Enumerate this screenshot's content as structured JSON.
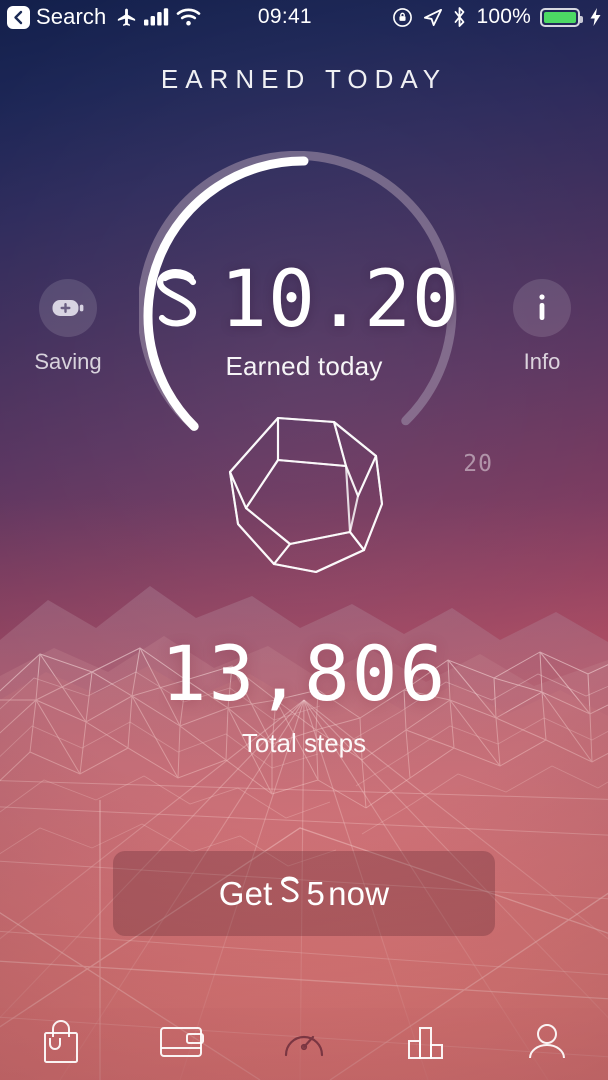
{
  "status_bar": {
    "back_label": "Search",
    "time": "09:41",
    "battery_percent": "100%",
    "icons": [
      "back-chevron-icon",
      "airplane-mode-icon",
      "cellular-signal-icon",
      "wifi-icon",
      "rotation-lock-icon",
      "location-arrow-icon",
      "bluetooth-icon",
      "battery-icon",
      "charging-bolt-icon"
    ],
    "battery_color": "#4cd964"
  },
  "header": {
    "title": "EARNED TODAY"
  },
  "earnings": {
    "currency_symbol": "sweatcoin-symbol",
    "amount": "10.20",
    "caption": "Earned today",
    "ring_max_label": "20",
    "ring_progress": 0.51,
    "ring_track_color": "#9b8ba4",
    "ring_progress_color": "#ffffff"
  },
  "side_actions": {
    "left": {
      "label": "Saving",
      "icon": "battery-plus-icon"
    },
    "right": {
      "label": "Info",
      "icon": "info-icon"
    }
  },
  "polyhedron": {
    "name": "dodecahedron-wireframe"
  },
  "steps": {
    "value": "13,806",
    "caption": "Total steps"
  },
  "cta": {
    "prefix": "Get",
    "symbol": "sweatcoin-symbol",
    "amount": "5",
    "suffix": "now",
    "full_label": "Get 5 now"
  },
  "tabbar": {
    "active": "dashboard",
    "items": [
      {
        "id": "shop",
        "icon": "shopping-bag-icon"
      },
      {
        "id": "wallet",
        "icon": "wallet-icon"
      },
      {
        "id": "dashboard",
        "icon": "speedometer-icon"
      },
      {
        "id": "stats",
        "icon": "bar-chart-icon"
      },
      {
        "id": "profile",
        "icon": "person-icon"
      }
    ]
  }
}
